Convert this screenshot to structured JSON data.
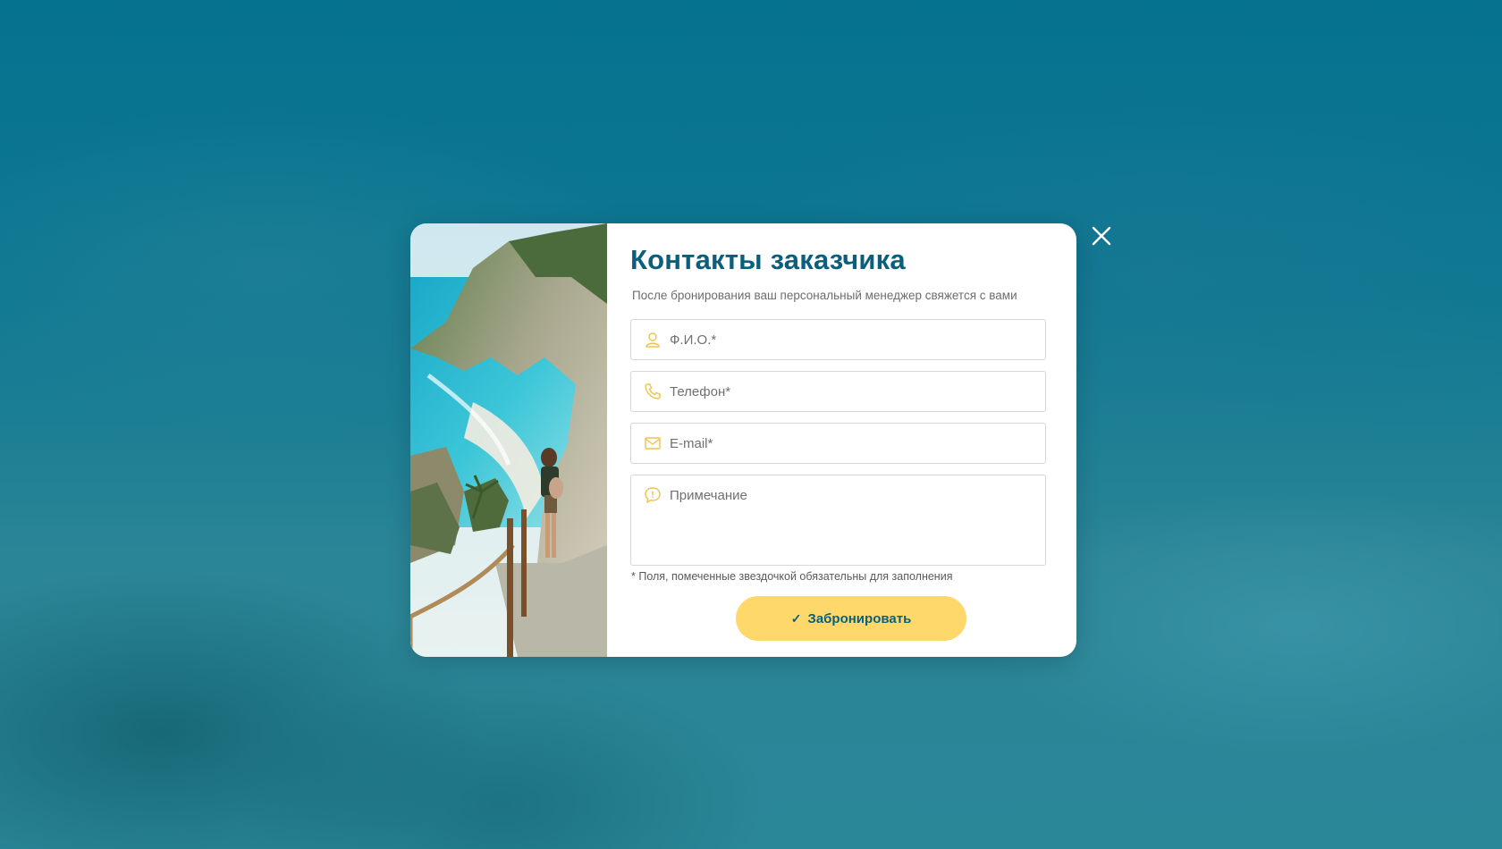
{
  "modal": {
    "title": "Контакты заказчика",
    "subtitle": "После бронирования ваш персональный менеджер свяжется с вами",
    "fields": [
      {
        "icon": "user-icon",
        "placeholder": "Ф.И.О.*",
        "value": ""
      },
      {
        "icon": "phone-icon",
        "placeholder": "Телефон*",
        "value": ""
      },
      {
        "icon": "envelope-icon",
        "placeholder": "E-mail*",
        "value": ""
      },
      {
        "icon": "comment-icon",
        "placeholder": "Примечание",
        "value": ""
      }
    ],
    "required_note": "* Поля, помеченные звездочкой обязательны для заполнения",
    "submit": {
      "icon": "check-icon",
      "label": "Забронировать"
    },
    "close_icon": "close-icon",
    "photo_icon": "beach-cliff-photo"
  },
  "colors": {
    "title": "#0b5f7c",
    "button": "#ffd86b",
    "icon_accent": "#f0c24b",
    "background": "#0a7490"
  }
}
